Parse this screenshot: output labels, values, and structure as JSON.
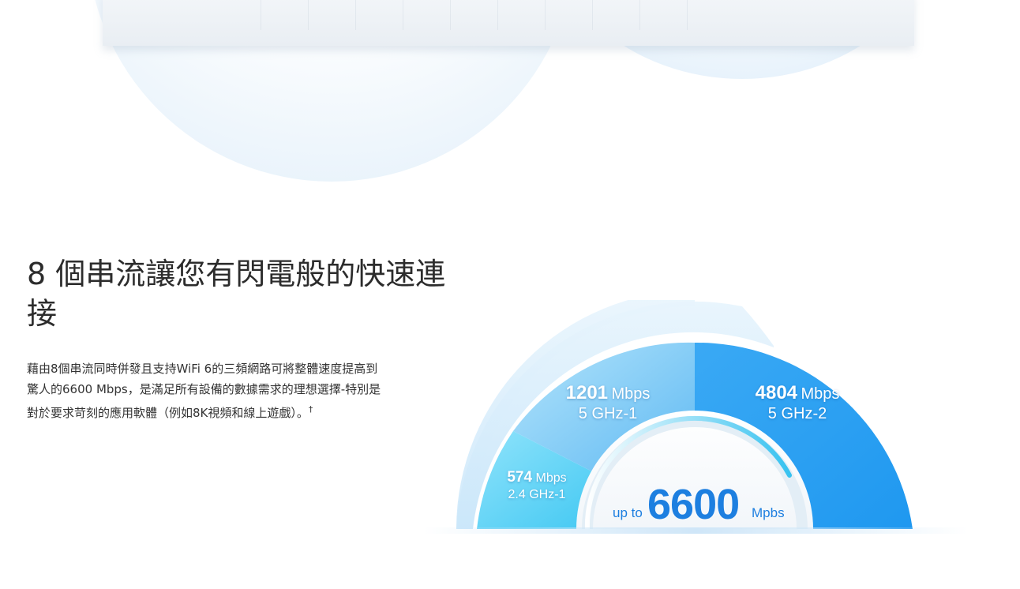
{
  "section": {
    "title": "8 個串流讓您有閃電般的快速連接",
    "description": "藉由8個串流同時併發且支持WiFi 6的三頻網路可將整體速度提高到驚人的6600 Mbps，是滿足所有設備的數據需求的理想選擇-特別是對於要求苛刻的應用軟體（例如8K視頻和線上遊戲）。",
    "footnote_mark": "†"
  },
  "gauge": {
    "bands": [
      {
        "value": "574",
        "unit": "Mbps",
        "band": "2.4 GHz-1"
      },
      {
        "value": "1201",
        "unit": "Mbps",
        "band": "5 GHz-1"
      },
      {
        "value": "4804",
        "unit": "Mbps",
        "band": "5 GHz-2"
      }
    ],
    "total": {
      "prefix": "up to",
      "value": "6600",
      "unit": "Mpbs"
    },
    "colors": {
      "band_24": "#5fd3f5",
      "band_5_1": "#7fc6f3",
      "band_5_2": "#2ea4f3",
      "accent": "#1d7fe0"
    }
  }
}
